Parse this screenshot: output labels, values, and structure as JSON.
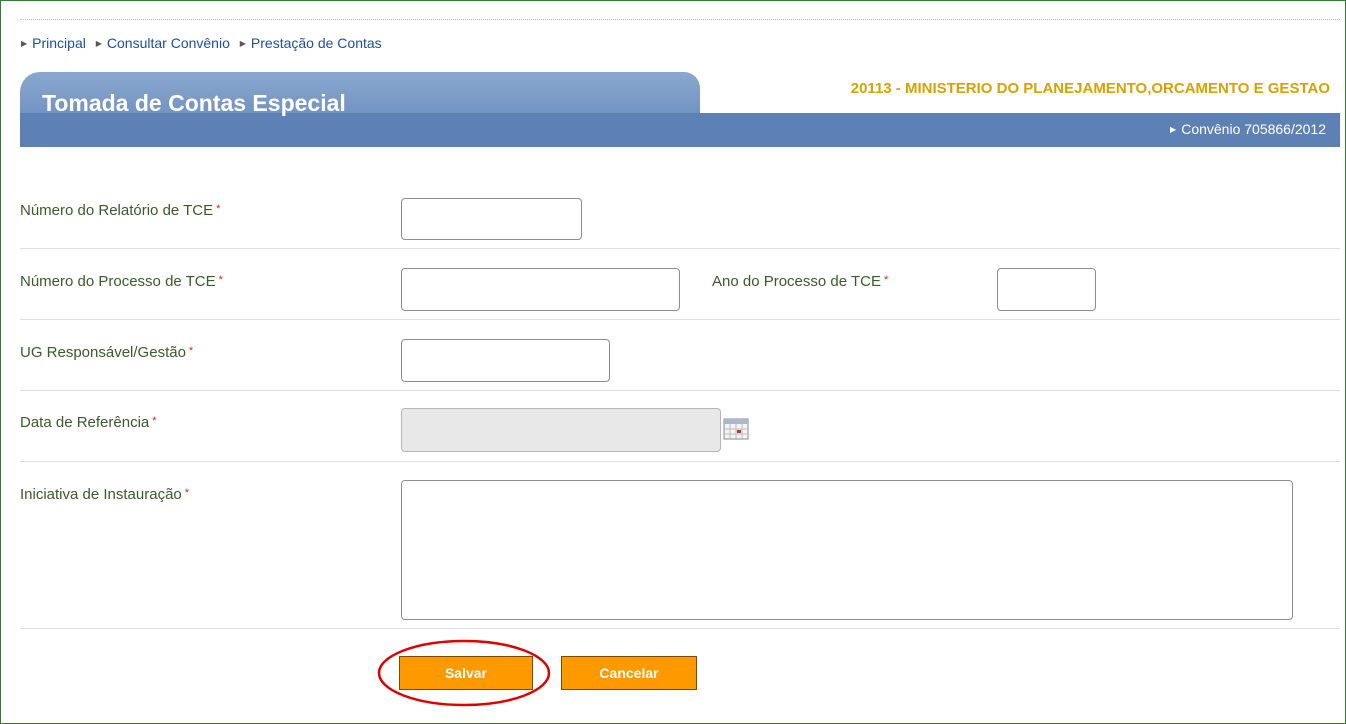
{
  "breadcrumb": [
    {
      "label": "Principal"
    },
    {
      "label": "Consultar Convênio"
    },
    {
      "label": "Prestação de Contas"
    }
  ],
  "header": {
    "title": "Tomada de Contas Especial",
    "ministry": "20113 - MINISTERIO DO PLANEJAMENTO,ORCAMENTO E GESTAO",
    "convenio": "Convênio 705866/2012"
  },
  "form": {
    "required_marker": "*",
    "numero_relatorio": {
      "label": "Número do Relatório de TCE",
      "value": ""
    },
    "numero_processo": {
      "label": "Número do Processo de TCE",
      "value": ""
    },
    "ano_processo": {
      "label": "Ano do Processo de TCE",
      "value": ""
    },
    "ug_responsavel": {
      "label": "UG Responsável/Gestão",
      "value": ""
    },
    "data_referencia": {
      "label": "Data de Referência",
      "value": ""
    },
    "iniciativa": {
      "label": "Iniciativa de Instauração",
      "value": ""
    }
  },
  "buttons": {
    "salvar": "Salvar",
    "cancelar": "Cancelar"
  },
  "icons": {
    "breadcrumb_arrow": "triangle-right-icon",
    "calendar": "calendar-icon"
  },
  "colors": {
    "header_band": "#5d80b5",
    "ministry_text": "#d8a300",
    "button": "#ff9900",
    "highlight": "#e00000"
  }
}
